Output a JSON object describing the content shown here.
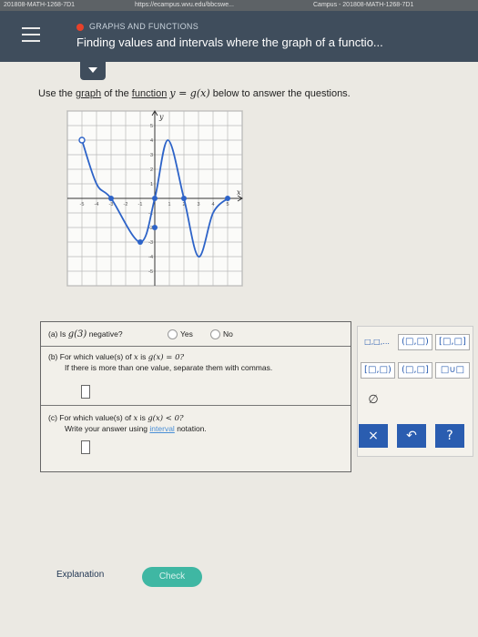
{
  "browser": {
    "tab_left": "201808-MATH-1268-7D1",
    "url": "https://ecampus.wvu.edu/bbcswe...",
    "tab_right": "Campus - 201808-MATH-1268-7D1"
  },
  "header": {
    "section": "GRAPHS AND FUNCTIONS",
    "title": "Finding values and intervals where the graph of a functio..."
  },
  "question": {
    "use_the": "Use the",
    "graph_link": "graph",
    "of_the": "of the",
    "function_link": "function",
    "func_expr": "y = g(x)",
    "rest": "below to answer the questions."
  },
  "graph": {
    "x_label": "x",
    "y_label": "y",
    "x_ticks": [
      "-5",
      "-4",
      "-3",
      "-2",
      "-1",
      "1",
      "2",
      "3",
      "4",
      "5"
    ],
    "y_ticks": [
      "5",
      "4",
      "3",
      "2",
      "1",
      "-1",
      "-2",
      "-3",
      "-4",
      "-5"
    ],
    "curve_color": "#2d63c8"
  },
  "chart_data": {
    "type": "line",
    "x_range": [
      -6,
      6
    ],
    "y_range": [
      -6,
      6
    ],
    "grid": true,
    "points": [
      {
        "x": -5,
        "y": 4,
        "endpoint": "open"
      },
      {
        "x": -4,
        "y": 1
      },
      {
        "x": -3,
        "y": 0
      },
      {
        "x": -1,
        "y": -3
      },
      {
        "x": 0,
        "y": 0
      },
      {
        "x": 0.9,
        "y": 4
      },
      {
        "x": 2,
        "y": 0
      },
      {
        "x": 3,
        "y": -4
      },
      {
        "x": 4,
        "y": -1
      },
      {
        "x": 5,
        "y": 0,
        "endpoint": "closed"
      }
    ],
    "marked_points": [
      {
        "x": -3,
        "y": 0
      },
      {
        "x": -1,
        "y": -3
      },
      {
        "x": 0,
        "y": 0
      },
      {
        "x": 0,
        "y": -2
      },
      {
        "x": 2,
        "y": 0
      },
      {
        "x": 5,
        "y": 0
      }
    ]
  },
  "part_a": {
    "label": "(a) Is",
    "expr": "g(3)",
    "tail": "negative?",
    "yes": "Yes",
    "no": "No"
  },
  "part_b": {
    "label": "(b) For which value(s) of",
    "var": "x",
    "is": "is",
    "expr": "g(x) = 0?",
    "note": "If there is more than one value, separate them with commas."
  },
  "part_c": {
    "label": "(c) For which value(s) of",
    "var": "x",
    "is": "is",
    "expr": "g(x) < 0?",
    "note_pre": "Write your answer using",
    "note_link": "interval",
    "note_post": "notation."
  },
  "tools": {
    "list": "□,□,...",
    "open_open": "(□,□)",
    "closed_closed": "[□,□]",
    "closed_open": "[□,□)",
    "open_closed": "(□,□]",
    "union": "□∪□",
    "empty": "∅",
    "clear": "×",
    "undo": "↶",
    "help": "?"
  },
  "footer": {
    "explanation": "Explanation",
    "check": "Check"
  },
  "colors": {
    "header": "#3f4d5c",
    "check_button": "#3fb7a3",
    "tool_action": "#2a5db0"
  }
}
